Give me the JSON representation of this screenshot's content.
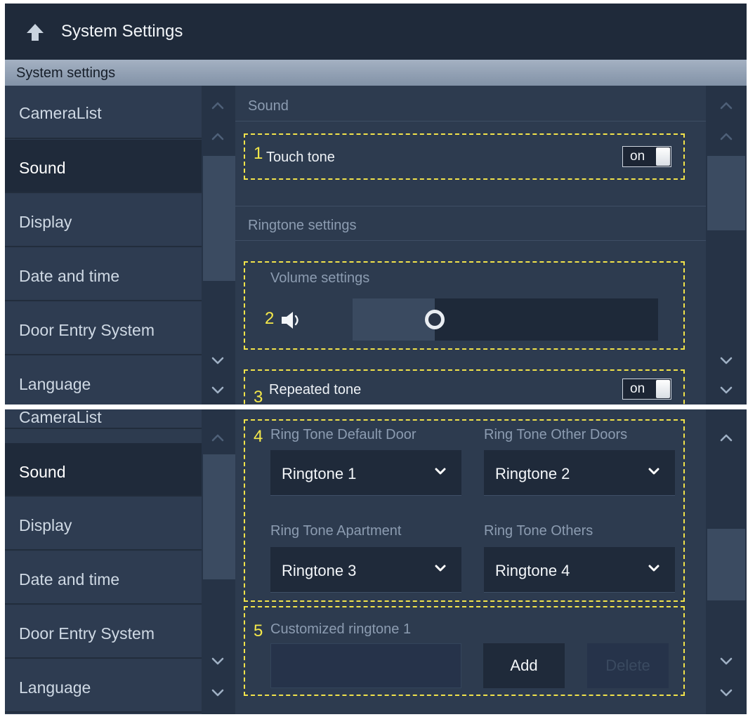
{
  "window": {
    "title": "System Settings",
    "subtitle": "System settings"
  },
  "nav": {
    "items": [
      {
        "label": "CameraList"
      },
      {
        "label": "Sound"
      },
      {
        "label": "Display"
      },
      {
        "label": "Date and time"
      },
      {
        "label": "Door Entry System"
      },
      {
        "label": "Language"
      }
    ],
    "active": "Sound"
  },
  "sound": {
    "section_title": "Sound",
    "touch_tone": {
      "number": "1",
      "label": "Touch tone",
      "state": "on"
    },
    "ringtone_section_title": "Ringtone settings",
    "volume": {
      "number": "2",
      "label": "Volume settings",
      "level_fraction": 0.27
    },
    "repeated_tone": {
      "number": "3",
      "label": "Repeated tone",
      "state": "on"
    },
    "ringtones": {
      "number": "4",
      "default_door": {
        "label": "Ring Tone Default Door",
        "value": "Ringtone 1"
      },
      "other_doors": {
        "label": "Ring Tone Other Doors",
        "value": "Ringtone 2"
      },
      "apartment": {
        "label": "Ring Tone Apartment",
        "value": "Ringtone 3"
      },
      "others": {
        "label": "Ring Tone Others",
        "value": "Ringtone 4"
      }
    },
    "customized": {
      "number": "5",
      "label": "Customized ringtone 1",
      "add_label": "Add",
      "delete_label": "Delete"
    }
  },
  "colors": {
    "highlight": "#f2e34a",
    "background": "#2d3b4f",
    "header": "#1f2a3a"
  }
}
